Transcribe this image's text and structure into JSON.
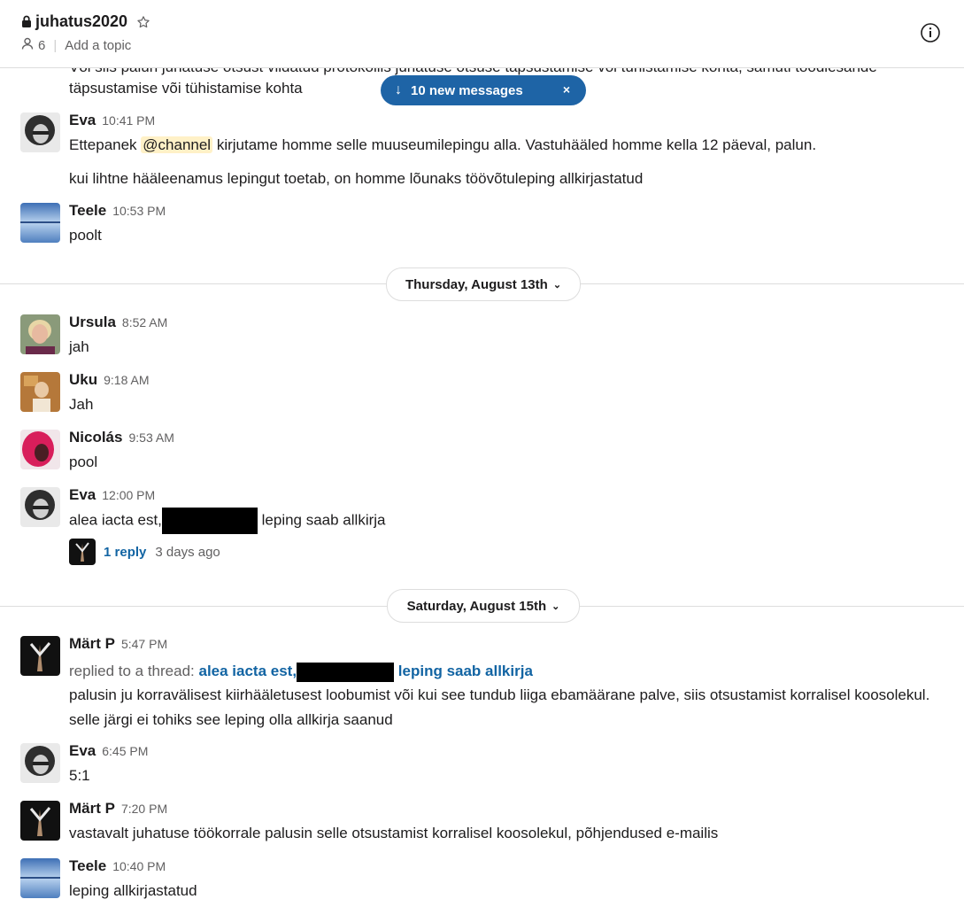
{
  "header": {
    "channel_name": "juhatus2020",
    "member_count": "6",
    "topic_placeholder": "Add a topic",
    "lock_icon": "lock-icon",
    "star_icon": "star-icon",
    "info_icon": "info-icon"
  },
  "new_messages_pill": {
    "label": "10 new messages",
    "close_label": "×"
  },
  "clipped_top_line": "Või siis palun juhatuse otsust viidatud protokollis juhatuse otsuse täpsustamise või tühistamise kohta, samuti töödlesande",
  "partial_text": "täpsustamise või tühistamise kohta",
  "messages": [
    {
      "name": "Eva",
      "time": "10:41 PM",
      "line1_pre": "Ettepanek ",
      "mention": "@channel",
      "line1_post": " kirjutame homme selle muuseumilepingu alla. Vastuhääled homme kella 12 päeval, palun.",
      "line2": "kui lihtne hääleenamus lepingut toetab, on homme lõunaks töövõtuleping allkirjastatud"
    },
    {
      "name": "Teele",
      "time": "10:53 PM",
      "text": "poolt"
    },
    {
      "name": "Ursula",
      "time": "8:52 AM",
      "text": "jah"
    },
    {
      "name": "Uku",
      "time": "9:18 AM",
      "text": "Jah"
    },
    {
      "name": "Nicolás",
      "time": "9:53 AM",
      "text": "pool"
    },
    {
      "name": "Eva",
      "time": "12:00 PM",
      "text_pre": "alea iacta est,",
      "text_post": " leping saab allkirja"
    },
    {
      "name": "Märt P",
      "time": "5:47 PM",
      "replied_label": "replied to a thread: ",
      "thread_pre": "alea iacta est,",
      "thread_post": " leping saab allkirja",
      "text": "palusin ju korravälisest kiirhääletusest loobumist või kui see tundub liiga ebamäärane palve, siis otsustamist korralisel koosolekul. selle järgi ei tohiks see leping olla allkirja saanud"
    },
    {
      "name": "Eva",
      "time": "6:45 PM",
      "text": "5:1"
    },
    {
      "name": "Märt P",
      "time": "7:20 PM",
      "text": "vastavalt juhatuse töökorrale palusin selle otsustamist korralisel koosolekul, põhjendused e-mailis"
    },
    {
      "name": "Teele",
      "time": "10:40 PM",
      "text": "leping allkirjastatud"
    }
  ],
  "thread_reply": {
    "count_label": "1 reply",
    "ago": "3 days ago"
  },
  "date_dividers": [
    {
      "label": "Thursday, August 13th"
    },
    {
      "label": "Saturday, August 15th"
    }
  ],
  "colors": {
    "link": "#1264a3",
    "pill": "#1e64a6",
    "mention_bg": "#fff1c7"
  }
}
